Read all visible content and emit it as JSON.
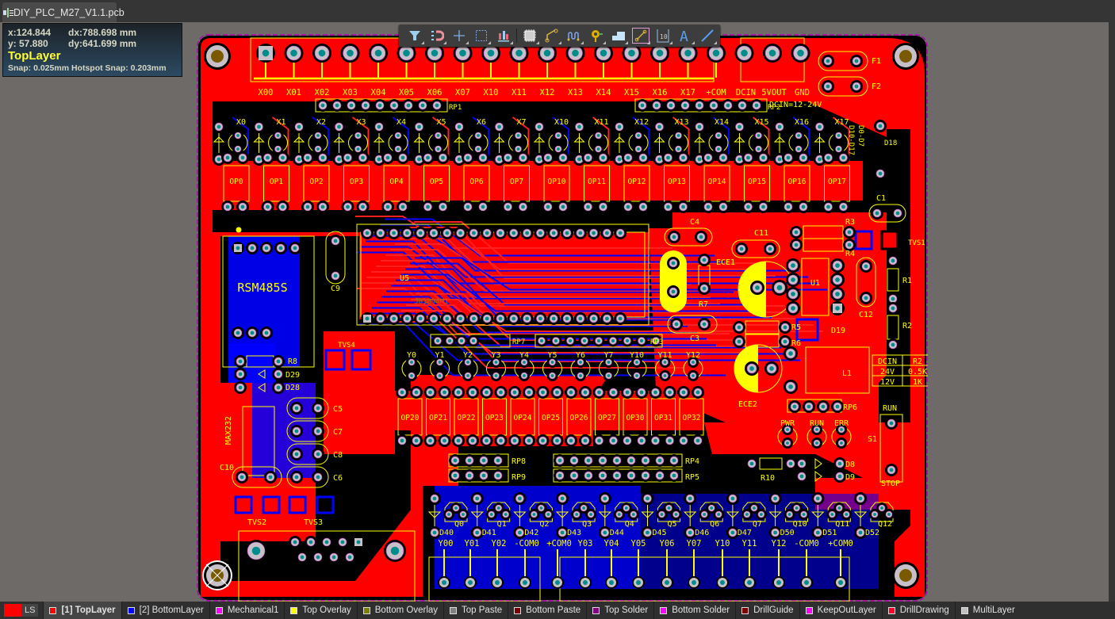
{
  "document_tab": {
    "title": "DIY_PLC_M27_V1.1.pcb",
    "icon": "pcb-file-icon"
  },
  "hud": {
    "x": "x:124.844",
    "dx": "dx:788.698 mm",
    "y": "y: 57.880",
    "dy": "dy:641.699 mm",
    "layer": "TopLayer",
    "snap": "Snap: 0.025mm Hotspot Snap: 0.203mm"
  },
  "toolbar": [
    {
      "name": "filter-icon",
      "tip": "Filter"
    },
    {
      "name": "snap-magnet-icon",
      "tip": "Snap"
    },
    {
      "name": "crosshair-icon",
      "tip": "Cursor"
    },
    {
      "name": "select-rect-icon",
      "tip": "Select"
    },
    {
      "name": "align-icon",
      "tip": "Align"
    },
    {
      "name": "component-icon",
      "tip": "Place Component"
    },
    {
      "name": "route-icon",
      "tip": "Interactive Routing"
    },
    {
      "name": "length-tune-icon",
      "tip": "Length Tuning"
    },
    {
      "name": "via-icon",
      "tip": "Place Via"
    },
    {
      "name": "polygon-icon",
      "tip": "Polygon Pour"
    },
    {
      "name": "diff-pair-icon",
      "tip": "Differential Pair"
    },
    {
      "name": "dimension-icon",
      "tip": "Dimension",
      "label": "10"
    },
    {
      "name": "text-icon",
      "tip": "String",
      "label": "A"
    },
    {
      "name": "line-icon",
      "tip": "Line"
    }
  ],
  "board": {
    "connector_top_labels": [
      "X00",
      "X01",
      "X02",
      "X03",
      "X04",
      "X05",
      "X06",
      "X07",
      "X10",
      "X11",
      "X12",
      "X13",
      "X14",
      "X15",
      "X16",
      "X17",
      "+COM",
      "DCIN",
      "5VOUT",
      "GND"
    ],
    "led_x_labels": [
      "X0",
      "X1",
      "X2",
      "X3",
      "X4",
      "X5",
      "X6",
      "X7",
      "X10",
      "X11",
      "X12",
      "X13",
      "X14",
      "X15",
      "X16",
      "X17"
    ],
    "op_top_labels": [
      "OP0",
      "OP1",
      "OP2",
      "OP3",
      "OP4",
      "OP5",
      "OP6",
      "OP7",
      "OP10",
      "OP11",
      "OP12",
      "OP13",
      "OP14",
      "OP15",
      "OP16",
      "OP17"
    ],
    "led_y_labels": [
      "Y0",
      "Y1",
      "Y2",
      "Y3",
      "Y4",
      "Y5",
      "Y6",
      "Y7",
      "Y10",
      "Y11",
      "Y12"
    ],
    "op_bottom_labels": [
      "OP20",
      "OP21",
      "OP22",
      "OP23",
      "OP24",
      "OP25",
      "OP26",
      "OP27",
      "OP30",
      "OP31",
      "OP32"
    ],
    "q_labels": [
      "Q0",
      "Q1",
      "Q2",
      "Q3",
      "Q4",
      "Q5",
      "Q6",
      "Q7",
      "Q10",
      "Q11",
      "Q12"
    ],
    "d_labels": [
      "D40",
      "D41",
      "D42",
      "D43",
      "D44",
      "D45",
      "D46",
      "D47",
      "D50",
      "D51",
      "D52"
    ],
    "connector_bottom_labels": [
      "Y00",
      "Y01",
      "Y02",
      "-COM0",
      "+COM0",
      "Y03",
      "Y04",
      "Y05",
      "Y06",
      "Y07",
      "Y10",
      "Y11",
      "Y12",
      "-COM0",
      "+COM0"
    ],
    "designators": {
      "rp1": "RP1",
      "rp2": "RP2",
      "rp3": "RP3",
      "rp4": "RP4",
      "rp5": "RP5",
      "rp6": "RP6",
      "rp7": "RP7",
      "rp8": "RP8",
      "rp9": "RP9",
      "f1": "F1",
      "f2": "F2",
      "dcin_note": "DCIN=12-24V",
      "d10_d17": "D10-D17",
      "d0_d7": "D0-D7",
      "d18": "D18",
      "c1": "C1",
      "c3": "C3",
      "c4": "C4",
      "c5": "C5",
      "c6": "C6",
      "c7": "C7",
      "c8": "C8",
      "c9": "C9",
      "c10": "C10",
      "c11": "C11",
      "c12": "C12",
      "r1": "R1",
      "r2": "R2",
      "r3": "R3",
      "r4": "R4",
      "r5": "R5",
      "r6": "R6",
      "r7": "R7",
      "r8": "R8",
      "r10": "R10",
      "u1": "U1",
      "u5": "U5",
      "ece1": "ECE1",
      "ece2": "ECE2",
      "l1": "L1",
      "d19": "D19",
      "tvs1": "TVS1",
      "tvs2": "TVS2",
      "tvs3": "TVS3",
      "tvs4": "TVS4",
      "d8": "D8",
      "d9": "D9",
      "d28": "D28",
      "d29": "D29",
      "s1": "S1",
      "run_top": "RUN",
      "stop": "STOP",
      "pwr": "PWR",
      "run": "RUN",
      "err": "ERR",
      "rsm": "RSM485S",
      "max232": "MAX232",
      "u5_value": "JD1894M1"
    },
    "r2_table": [
      [
        "DCIN",
        "R2"
      ],
      [
        "24V",
        "0.5K"
      ],
      [
        "12V",
        "1K"
      ]
    ]
  },
  "layers": {
    "ls_label": "LS",
    "tabs": [
      {
        "label": "[1] TopLayer",
        "color": "#ff0000",
        "active": true
      },
      {
        "label": "[2] BottomLayer",
        "color": "#0000ff"
      },
      {
        "label": "Mechanical1",
        "color": "#ff00ff"
      },
      {
        "label": "Top Overlay",
        "color": "#ffff00"
      },
      {
        "label": "Bottom Overlay",
        "color": "#808000"
      },
      {
        "label": "Top Paste",
        "color": "#808080"
      },
      {
        "label": "Bottom Paste",
        "color": "#800000"
      },
      {
        "label": "Top Solder",
        "color": "#800080"
      },
      {
        "label": "Bottom Solder",
        "color": "#ff00ff"
      },
      {
        "label": "DrillGuide",
        "color": "#800000"
      },
      {
        "label": "KeepOutLayer",
        "color": "#ff00ff"
      },
      {
        "label": "DrillDrawing",
        "color": "#ff002a"
      },
      {
        "label": "MultiLayer",
        "color": "#c0c0c0"
      }
    ]
  },
  "colors": {
    "top": "#ff0000",
    "bottom": "#0000ff",
    "overlay": "#ffff00",
    "pad": "#c8c0c8",
    "hole": "#008c8c",
    "board_bg": "#000000",
    "mount": "#7a5a00"
  }
}
